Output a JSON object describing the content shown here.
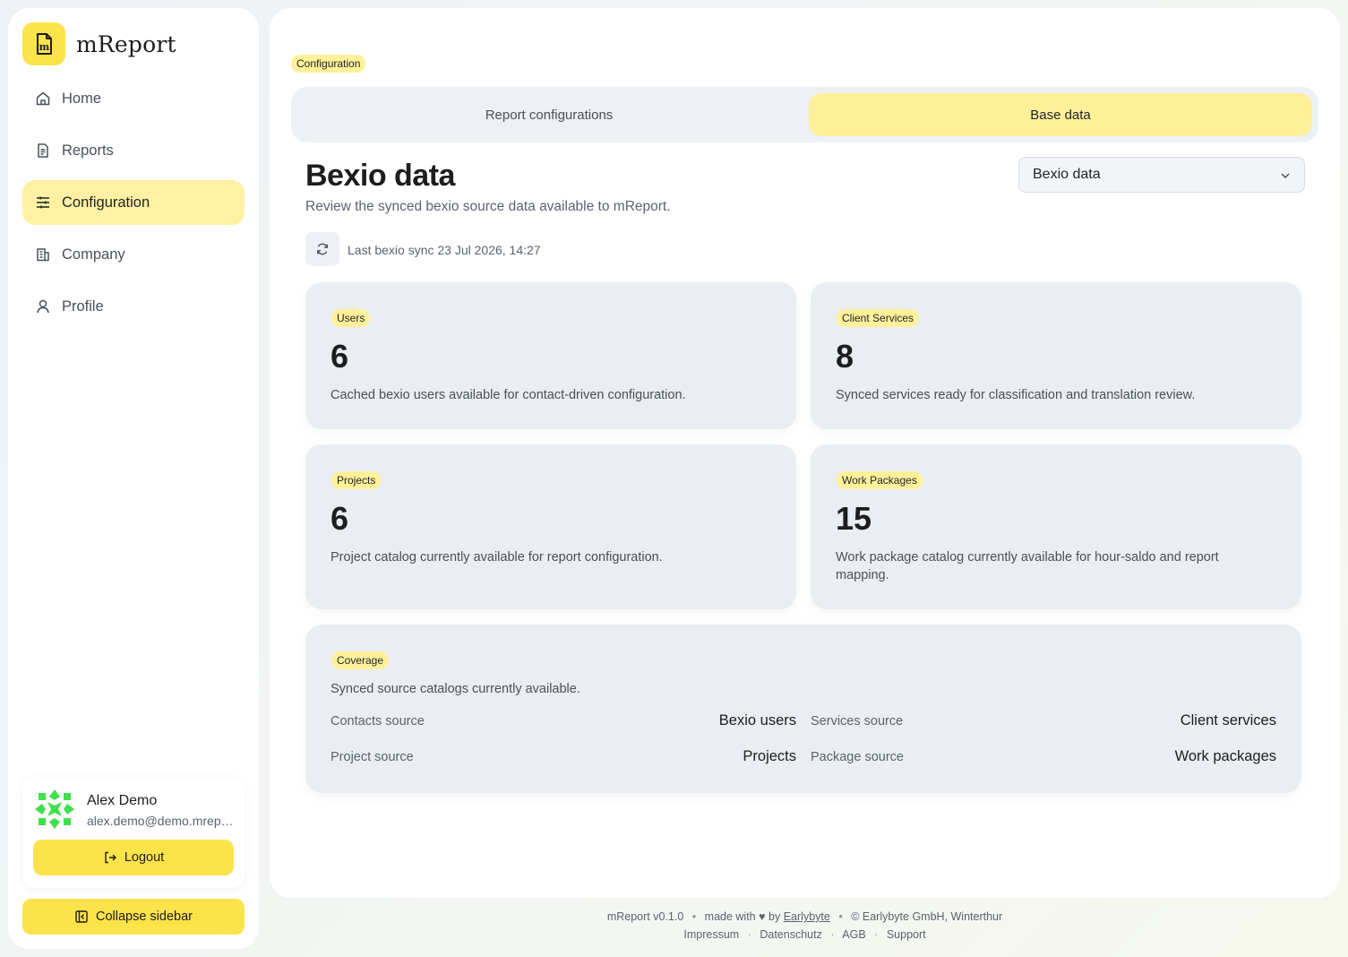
{
  "brand": {
    "name": "mReport"
  },
  "nav": [
    {
      "label": "Home",
      "icon": "home-icon"
    },
    {
      "label": "Reports",
      "icon": "report-icon"
    },
    {
      "label": "Configuration",
      "icon": "sliders-icon"
    },
    {
      "label": "Company",
      "icon": "building-icon"
    },
    {
      "label": "Profile",
      "icon": "user-icon"
    }
  ],
  "user": {
    "name": "Alex Demo",
    "email": "alex.demo@demo.mreport.ch",
    "logout_label": "Logout"
  },
  "collapse_label": "Collapse sidebar",
  "breadcrumb": "Configuration",
  "tabs": [
    {
      "label": "Report configurations"
    },
    {
      "label": "Base data"
    }
  ],
  "page": {
    "title": "Bexio data",
    "subtitle": "Review the synced bexio source data available to mReport.",
    "select_value": "Bexio data",
    "last_sync": "Last bexio sync 23 Jul 2026, 14:27"
  },
  "cards": [
    {
      "badge": "Users",
      "value": "6",
      "description": "Cached bexio users available for contact-driven configuration."
    },
    {
      "badge": "Client Services",
      "value": "8",
      "description": "Synced services ready for classification and translation review."
    },
    {
      "badge": "Projects",
      "value": "6",
      "description": "Project catalog currently available for report configuration."
    },
    {
      "badge": "Work Packages",
      "value": "15",
      "description": "Work package catalog currently available for hour-saldo and report mapping."
    }
  ],
  "coverage": {
    "badge": "Coverage",
    "description": "Synced source catalogs currently available.",
    "rows": [
      {
        "label": "Contacts source",
        "value": "Bexio users"
      },
      {
        "label": "Services source",
        "value": "Client services"
      },
      {
        "label": "Project source",
        "value": "Projects"
      },
      {
        "label": "Package source",
        "value": "Work packages"
      }
    ]
  },
  "footer": {
    "version": "mReport v0.1.0",
    "made_with": "made with",
    "by": "by",
    "company_link": "Earlybyte",
    "copyright": "© Earlybyte GmbH, Winterthur",
    "links": [
      "Impressum",
      "Datenschutz",
      "AGB",
      "Support"
    ]
  },
  "colors": {
    "accent": "#fde34a",
    "accent_soft": "#fff09a",
    "card_bg": "#eaeef2"
  }
}
